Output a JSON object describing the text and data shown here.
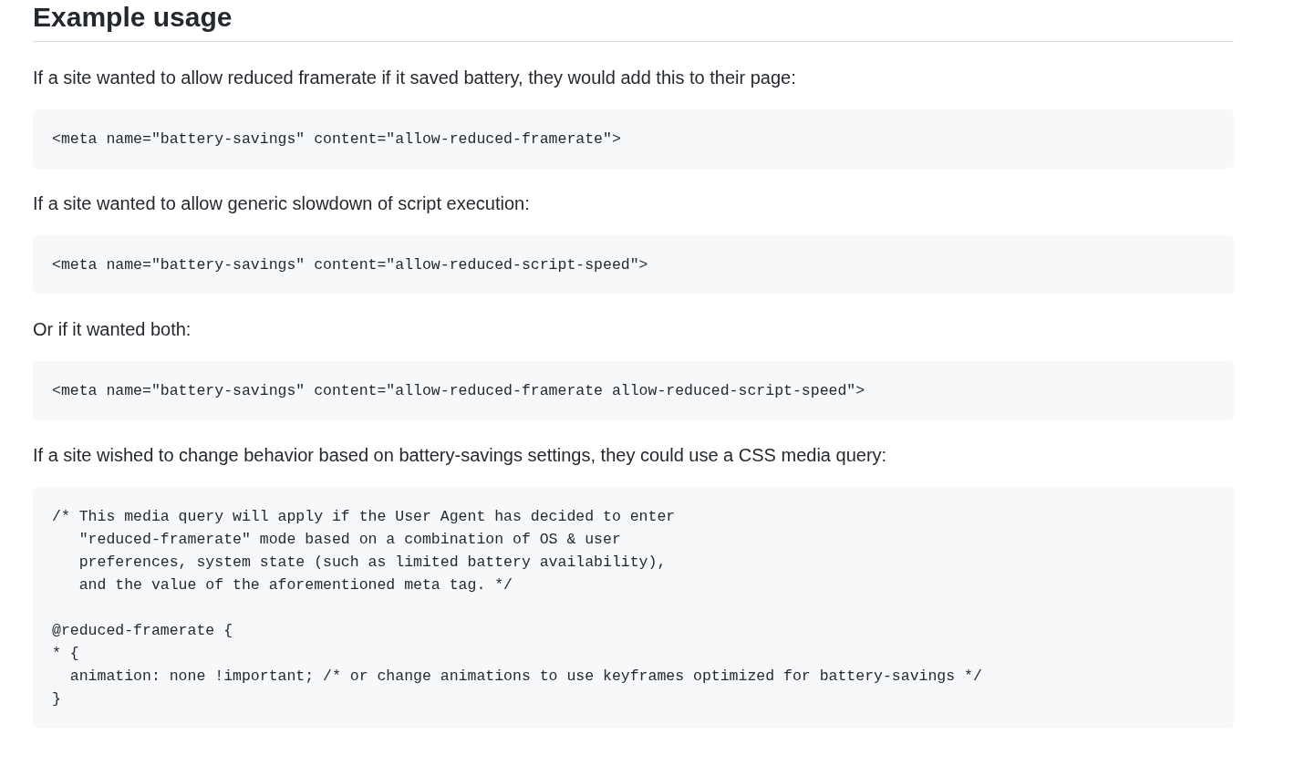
{
  "heading": "Example usage",
  "blocks": [
    {
      "kind": "paragraph",
      "text": "If a site wanted to allow reduced framerate if it saved battery, they would add this to their page:"
    },
    {
      "kind": "code",
      "text": "<meta name=\"battery-savings\" content=\"allow-reduced-framerate\">"
    },
    {
      "kind": "paragraph",
      "text": "If a site wanted to allow generic slowdown of script execution:"
    },
    {
      "kind": "code",
      "text": "<meta name=\"battery-savings\" content=\"allow-reduced-script-speed\">"
    },
    {
      "kind": "paragraph",
      "text": "Or if it wanted both:"
    },
    {
      "kind": "code",
      "text": "<meta name=\"battery-savings\" content=\"allow-reduced-framerate allow-reduced-script-speed\">"
    },
    {
      "kind": "paragraph",
      "text": "If a site wished to change behavior based on battery-savings settings, they could use a CSS media query:"
    },
    {
      "kind": "code",
      "text": "/* This media query will apply if the User Agent has decided to enter\n   \"reduced-framerate\" mode based on a combination of OS & user\n   preferences, system state (such as limited battery availability),\n   and the value of the aforementioned meta tag. */\n\n@reduced-framerate {\n* {\n  animation: none !important; /* or change animations to use keyframes optimized for battery-savings */\n}"
    }
  ]
}
